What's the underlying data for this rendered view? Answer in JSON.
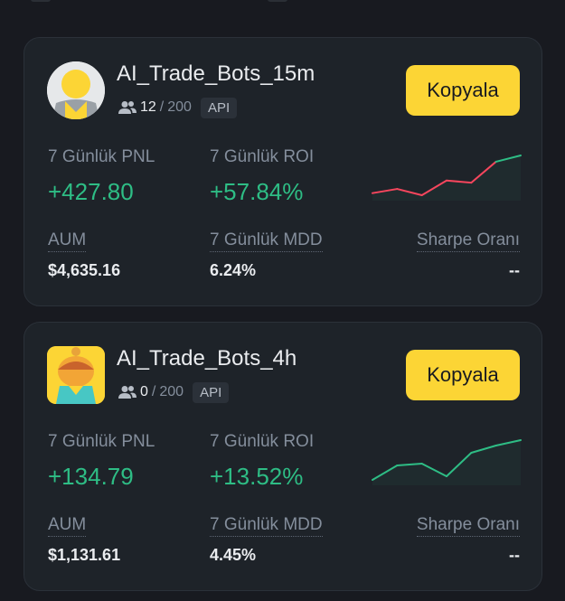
{
  "cards": [
    {
      "name": "AI_Trade_Bots_15m",
      "followers_current": "12",
      "followers_sep": "/",
      "followers_max": "200",
      "badge": "API",
      "copy_label": "Kopyala",
      "pnl_label": "7 Günlük PNL",
      "pnl_value": "+427.80",
      "roi_label": "7 Günlük ROI",
      "roi_value": "+57.84%",
      "aum_label": "AUM",
      "aum_value": "$4,635.16",
      "mdd_label": "7 Günlük MDD",
      "mdd_value": "6.24%",
      "sharpe_label": "Sharpe Oranı",
      "sharpe_value": "--",
      "sparkline": [
        0.25,
        0.35,
        0.2,
        0.55,
        0.5,
        1.0,
        1.15
      ],
      "spark_colors": [
        "#f6465d",
        "#2ebd85"
      ]
    },
    {
      "name": "AI_Trade_Bots_4h",
      "followers_current": "0",
      "followers_sep": "/",
      "followers_max": "200",
      "badge": "API",
      "copy_label": "Kopyala",
      "pnl_label": "7 Günlük PNL",
      "pnl_value": "+134.79",
      "roi_label": "7 Günlük ROI",
      "roi_value": "+13.52%",
      "aum_label": "AUM",
      "aum_value": "$1,131.61",
      "mdd_label": "7 Günlük MDD",
      "mdd_value": "4.45%",
      "sharpe_label": "Sharpe Oranı",
      "sharpe_value": "--",
      "sparkline": [
        0.0,
        0.4,
        0.45,
        0.1,
        0.75,
        0.95,
        1.1
      ],
      "spark_colors": [
        "#2ebd85",
        "#2ebd85"
      ]
    }
  ]
}
